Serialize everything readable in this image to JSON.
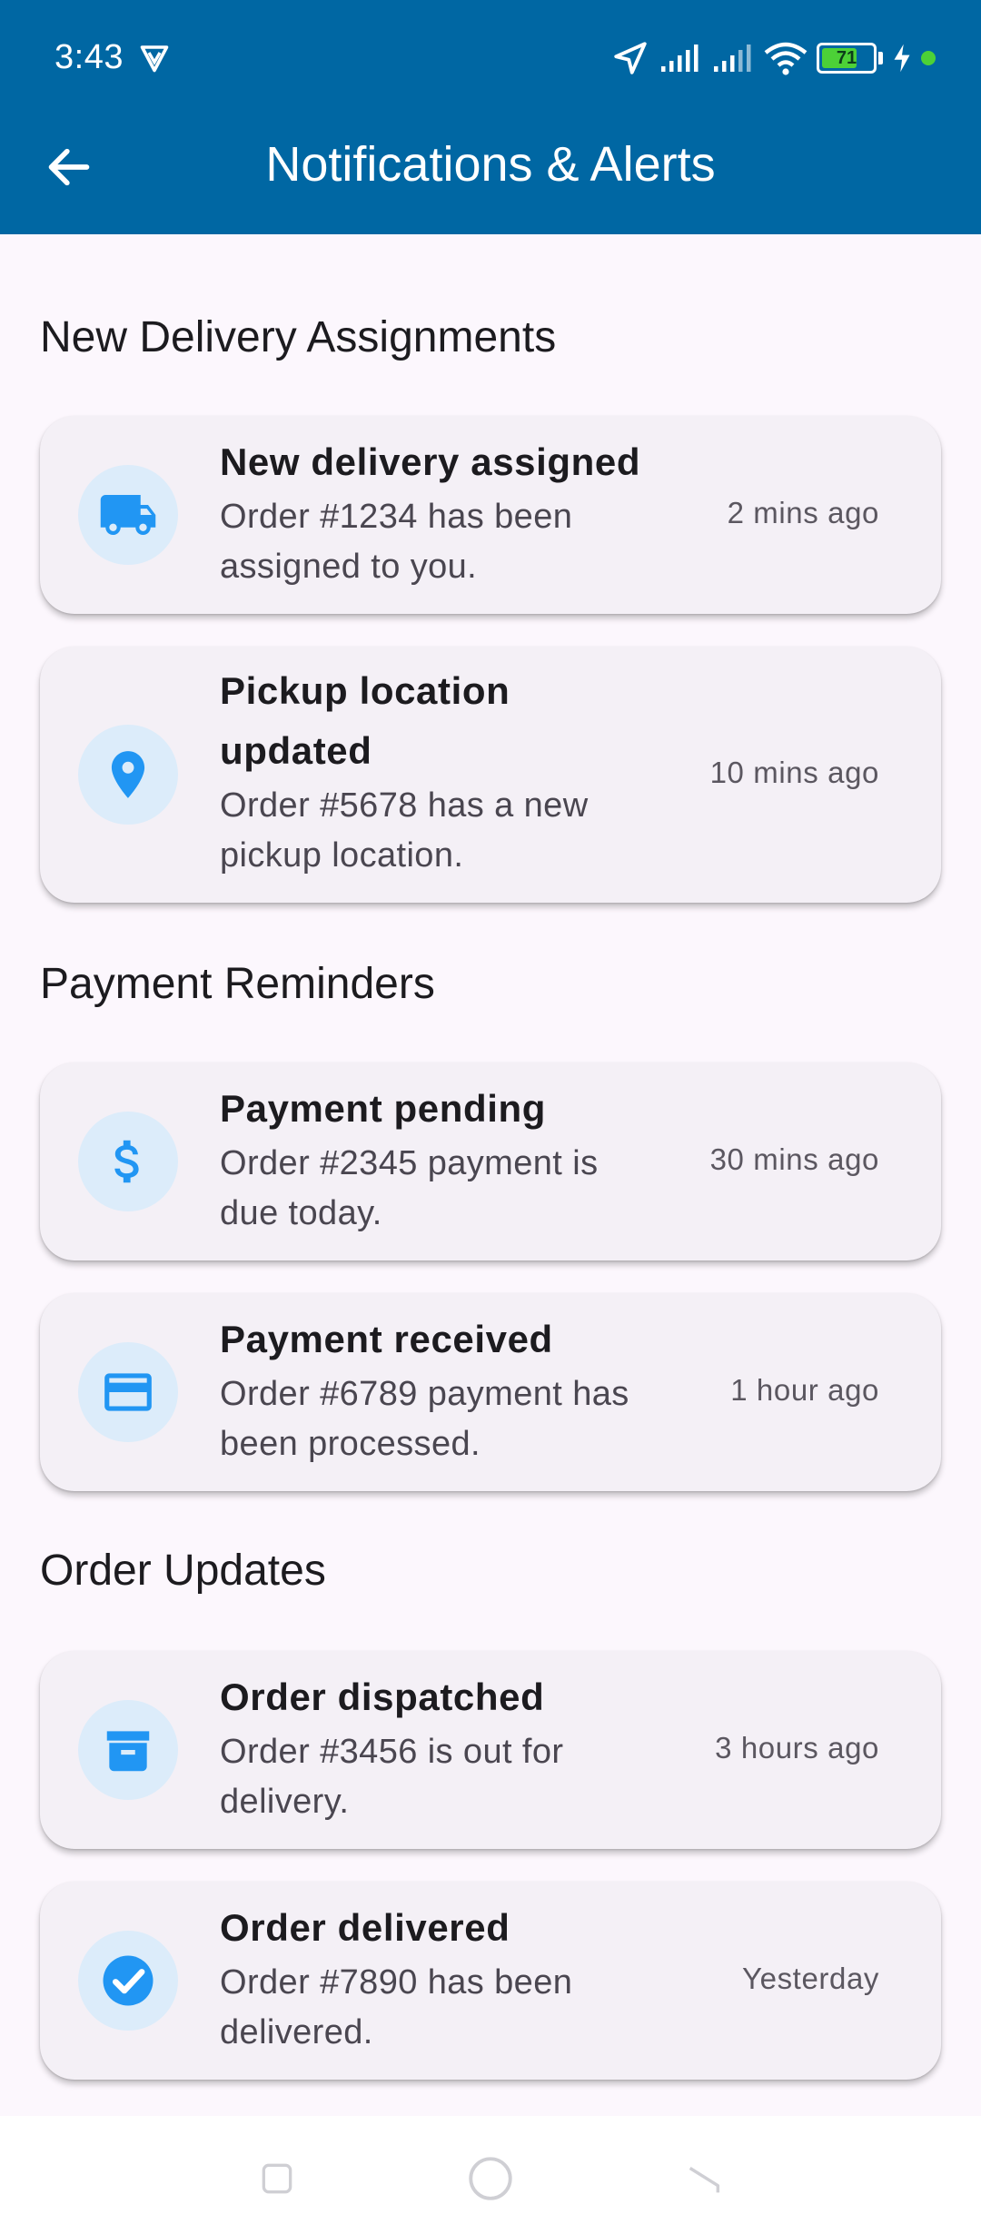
{
  "status_bar": {
    "time": "3:43",
    "battery_level": "71",
    "battery_fraction": 0.71,
    "icons": [
      "vpn-icon",
      "location-arrow-icon",
      "signal-icon",
      "signal-icon",
      "wifi-icon",
      "battery-icon",
      "charging-icon",
      "dot-indicator"
    ]
  },
  "app_bar": {
    "title": "Notifications & Alerts",
    "back_icon": "arrow-left-icon",
    "color": "#0067a3"
  },
  "sections": [
    {
      "title": "New Delivery Assignments",
      "items": [
        {
          "icon": "truck-icon",
          "title_lines": [
            "New delivery assigned"
          ],
          "body_lines": [
            "Order #1234 has been",
            "assigned to you."
          ],
          "time": "2 mins ago"
        },
        {
          "icon": "location-pin-icon",
          "title_lines": [
            "Pickup location",
            "updated"
          ],
          "body_lines": [
            "Order #5678 has a new",
            "pickup location."
          ],
          "time": "10 mins ago"
        }
      ]
    },
    {
      "title": "Payment Reminders",
      "items": [
        {
          "icon": "dollar-icon",
          "title_lines": [
            "Payment pending"
          ],
          "body_lines": [
            "Order #2345 payment is",
            "due today."
          ],
          "time": "30 mins ago"
        },
        {
          "icon": "credit-card-icon",
          "title_lines": [
            "Payment received"
          ],
          "body_lines": [
            "Order #6789 payment has",
            "been processed."
          ],
          "time": "1 hour ago"
        }
      ]
    },
    {
      "title": "Order Updates",
      "items": [
        {
          "icon": "archive-box-icon",
          "title_lines": [
            "Order dispatched"
          ],
          "body_lines": [
            "Order #3456 is out for",
            "delivery."
          ],
          "time": "3 hours ago"
        },
        {
          "icon": "check-circle-icon",
          "title_lines": [
            "Order delivered"
          ],
          "body_lines": [
            "Order #7890 has been",
            "delivered."
          ],
          "time": "Yesterday"
        }
      ]
    }
  ],
  "colors": {
    "accent": "#2196f3",
    "icon_background": "#dcecfa",
    "card_background": "#f4f0f6",
    "page_background": "#fcf7fd"
  },
  "nav_bar": {
    "buttons": [
      "recents-square-icon",
      "home-circle-icon",
      "back-triangle-icon"
    ]
  }
}
